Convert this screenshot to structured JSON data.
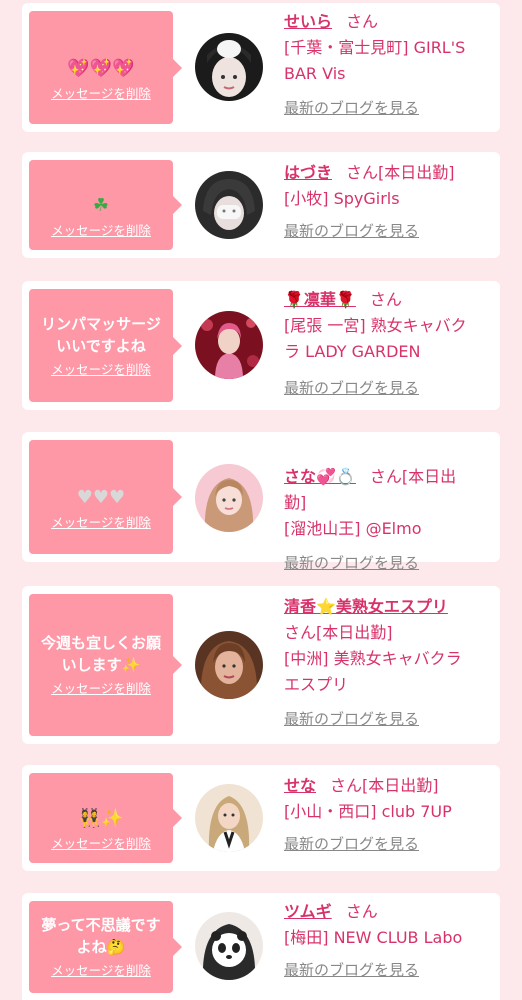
{
  "common": {
    "delete_label": "メッセージを削除",
    "blog_label": "最新のブログを見る",
    "san": "さん"
  },
  "items": [
    {
      "message": "",
      "icons": [
        "sparkling-heart-icon",
        "sparkling-heart-icon",
        "sparkling-heart-icon"
      ],
      "icon_glyph": "💖💖💖",
      "name": "せいら",
      "status": "",
      "shop": "[千葉・富士見町] GIRL'S\nBAR Vis",
      "avatar_colors": [
        "#1b1b1b",
        "#e9e1e0"
      ]
    },
    {
      "message": "",
      "icons": [
        "clover-icon"
      ],
      "icon_glyph": "☘",
      "name": "はづき",
      "status": "[本日出勤]",
      "shop": "[小牧] SpyGirls",
      "avatar_colors": [
        "#2b2b2b",
        "#dcdcdc"
      ]
    },
    {
      "message": "リンパマッサージ\nいいですよね",
      "icons": [],
      "icon_glyph": "",
      "name_prefix_icon": "rose-icon",
      "name": "🌹凛華🌹",
      "status": "",
      "shop": "[尾張 一宮] 熟女キャバク\nラ LADY GARDEN",
      "avatar_colors": [
        "#7a1020",
        "#e0638c"
      ]
    },
    {
      "message": "",
      "icons": [
        "white-heart-icon",
        "white-heart-icon",
        "white-heart-icon"
      ],
      "icon_glyph": "♥♥♥",
      "name": "さな💞💍",
      "status": "[本日出\n勤]",
      "shop": "[溜池山王] @Elmo",
      "avatar_colors": [
        "#f6c9d3",
        "#ea9eb0"
      ]
    },
    {
      "message": "今週も宜しくお願\nいします✨",
      "icons": [],
      "icon_glyph": "",
      "name": "清香⭐美熟女エスプリ",
      "status": "[本日出勤]",
      "shop": "[中洲] 美熟女キャバクラ\nエスプリ",
      "avatar_colors": [
        "#5a3423",
        "#d8a089"
      ]
    },
    {
      "message": "",
      "icons": [
        "dancers-icon",
        "sparkles-icon"
      ],
      "icon_glyph": "👯✨",
      "name": "せな",
      "status": "[本日出勤]",
      "shop": "[小山・西口] club 7UP",
      "avatar_colors": [
        "#c9a97a",
        "#f1e3d3"
      ]
    },
    {
      "message": "夢って不思議です\nよね🤔",
      "icons": [],
      "icon_glyph": "",
      "name": "ツムギ",
      "status": "",
      "shop": "[梅田] NEW CLUB Labo",
      "avatar_colors": [
        "#efe9e6",
        "#2a2a2a"
      ]
    }
  ]
}
